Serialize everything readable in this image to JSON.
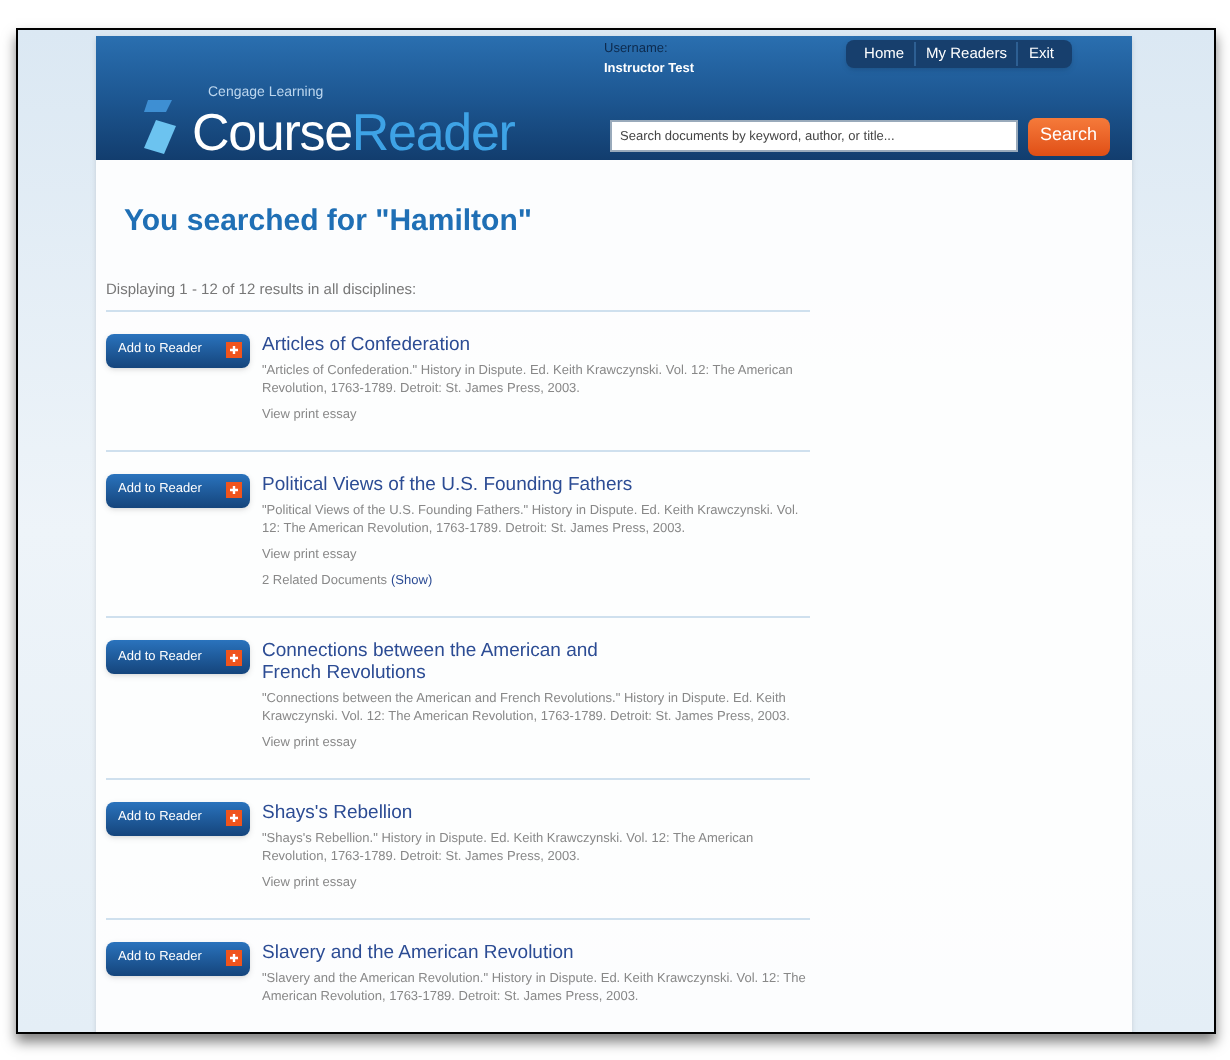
{
  "header": {
    "brand_small": "Cengage Learning",
    "brand_first": "Course",
    "brand_second": "Reader",
    "user_label": "Username:",
    "user_name": "Instructor Test",
    "nav": [
      "Home",
      "My Readers",
      "Exit"
    ],
    "search": {
      "placeholder": "Search documents by keyword, author, or title...",
      "button": "Search"
    }
  },
  "heading": "You searched for \"Hamilton\"",
  "summary": "Displaying 1 - 12 of 12 results in all disciplines:",
  "results": [
    {
      "button": "Add to Reader",
      "title": "Articles of Confederation",
      "citation": "\"Articles of Confederation.\" History in Dispute. Ed. Keith Krawczynski. Vol. 12: The American Revolution, 1763-1789. Detroit: St. James Press, 2003.",
      "link": "View print essay"
    },
    {
      "button": "Add to Reader",
      "title": "Political Views of the U.S. Founding Fathers",
      "citation": "\"Political Views of the U.S. Founding Fathers.\" History in Dispute. Ed. Keith Krawczynski. Vol. 12: The American Revolution, 1763-1789. Detroit: St. James Press, 2003.",
      "link": "View print essay",
      "related": "2 Related Documents",
      "related_toggle": "(Show)"
    },
    {
      "button": "Add to Reader",
      "title": "Connections between the American and French Revolutions",
      "citation": "\"Connections between the American and French Revolutions.\" History in Dispute. Ed. Keith Krawczynski. Vol. 12: The American Revolution, 1763-1789. Detroit: St. James Press, 2003.",
      "link": "View print essay"
    },
    {
      "button": "Add to Reader",
      "title": "Shays's Rebellion",
      "citation": "\"Shays's Rebellion.\" History in Dispute. Ed. Keith Krawczynski. Vol. 12: The American Revolution, 1763-1789. Detroit: St. James Press, 2003.",
      "link": "View print essay"
    },
    {
      "button": "Add to Reader",
      "title": "Slavery and the American Revolution",
      "citation": "\"Slavery and the American Revolution.\" History in Dispute. Ed. Keith Krawczynski. Vol. 12: The American Revolution, 1763-1789. Detroit: St. James Press, 2003."
    }
  ]
}
